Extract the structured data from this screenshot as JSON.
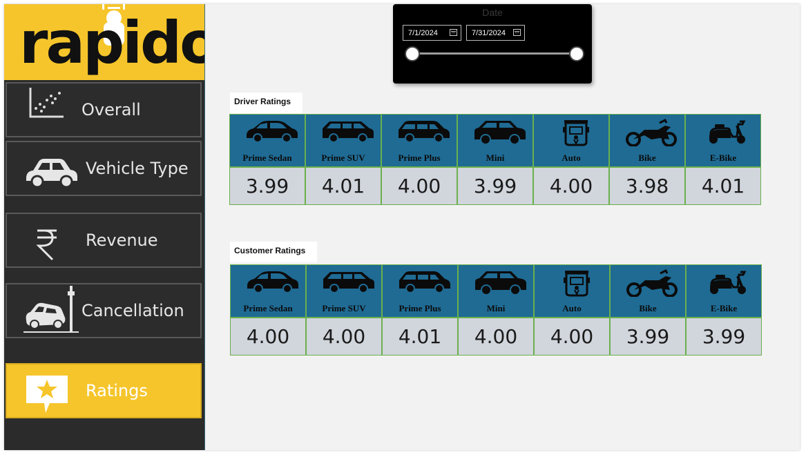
{
  "brand": {
    "logo_text": "rapido",
    "accent": "#f5c52b"
  },
  "sidebar": {
    "items": [
      {
        "label": "Overall",
        "icon": "scatter-chart-icon",
        "active": false
      },
      {
        "label": "Vehicle Type",
        "icon": "car-icon",
        "active": false
      },
      {
        "label": "Revenue",
        "icon": "rupee-icon",
        "active": false
      },
      {
        "label": "Cancellation",
        "icon": "car-crash-icon",
        "active": false
      },
      {
        "label": "Ratings",
        "icon": "star-message-icon",
        "active": true
      }
    ]
  },
  "date_slicer": {
    "title": "Date",
    "start": "7/1/2024",
    "end": "7/31/2024"
  },
  "driver_ratings": {
    "title": "Driver Ratings",
    "vehicles": [
      {
        "name": "Prime Sedan",
        "icon": "sedan-icon",
        "value": "3.99"
      },
      {
        "name": "Prime SUV",
        "icon": "suv-icon",
        "value": "4.01"
      },
      {
        "name": "Prime Plus",
        "icon": "hatchback-icon",
        "value": "4.00"
      },
      {
        "name": "Mini",
        "icon": "mini-car-icon",
        "value": "3.99"
      },
      {
        "name": "Auto",
        "icon": "auto-rickshaw-icon",
        "value": "4.00"
      },
      {
        "name": "Bike",
        "icon": "motorbike-icon",
        "value": "3.98"
      },
      {
        "name": "E-Bike",
        "icon": "scooter-icon",
        "value": "4.01"
      }
    ]
  },
  "customer_ratings": {
    "title": "Customer Ratings",
    "vehicles": [
      {
        "name": "Prime Sedan",
        "icon": "sedan-icon",
        "value": "4.00"
      },
      {
        "name": "Prime SUV",
        "icon": "suv-icon",
        "value": "4.00"
      },
      {
        "name": "Prime Plus",
        "icon": "hatchback-icon",
        "value": "4.01"
      },
      {
        "name": "Mini",
        "icon": "mini-car-icon",
        "value": "4.00"
      },
      {
        "name": "Auto",
        "icon": "auto-rickshaw-icon",
        "value": "4.00"
      },
      {
        "name": "Bike",
        "icon": "motorbike-icon",
        "value": "3.99"
      },
      {
        "name": "E-Bike",
        "icon": "scooter-icon",
        "value": "3.99"
      }
    ]
  }
}
